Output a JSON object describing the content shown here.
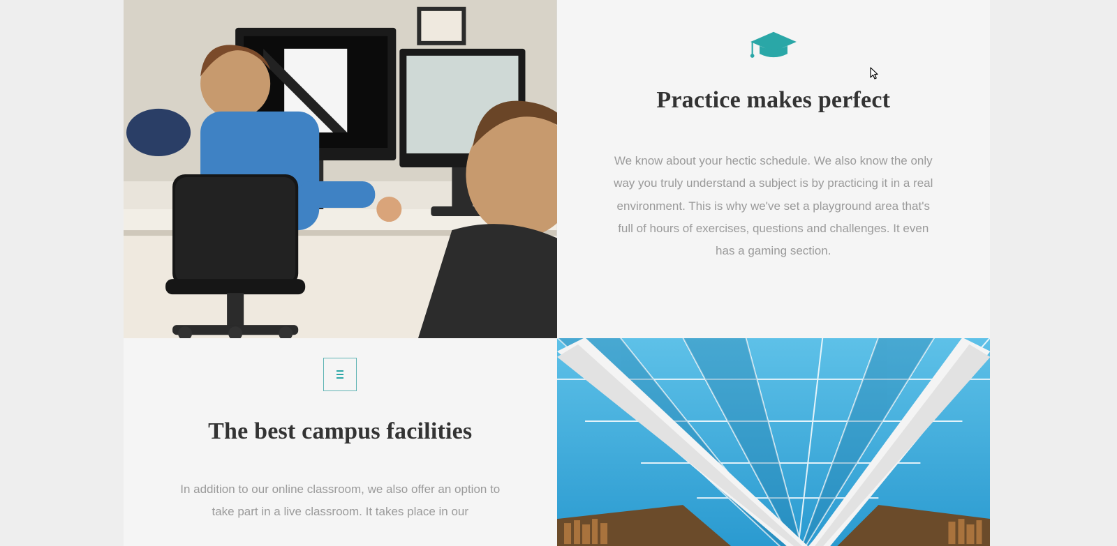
{
  "colors": {
    "accent": "#2aa7a7",
    "heading": "#333333",
    "body": "#9a9a9a",
    "panel": "#f5f5f5",
    "page_bg": "#eeeeee"
  },
  "sections": [
    {
      "icon": "graduation-cap",
      "title": "Practice makes perfect",
      "body": "We know about your hectic schedule. We also know the only way you truly understand a subject is by practicing it in a real environment. This is why we've set a playground area that's full of hours of exercises, questions and challenges. It even has a gaming section."
    },
    {
      "icon": "building",
      "title": "The best campus facilities",
      "body": "In addition to our online classroom, we also offer an option to take part in a live classroom. It takes place in our"
    }
  ]
}
